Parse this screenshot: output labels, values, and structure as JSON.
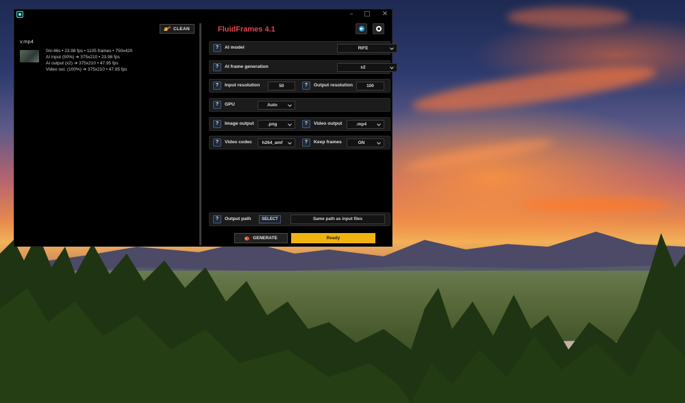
{
  "window": {
    "controls": {
      "minimize": "–",
      "maximize": "□",
      "close": "✕"
    }
  },
  "left_panel": {
    "clean_label": "CLEAN",
    "file_name": "v.mp4",
    "file_info": [
      "0m:46s • 23.98 fps • 1105 frames • 750x420",
      "AI input (50%) ➔ 375x210 • 23.98 fps",
      "AI output (x2) ➔ 375x210 • 47.95 fps",
      "Video out. (100%) ➔ 375x210 • 47.95 fps"
    ]
  },
  "header": {
    "title": "FluidFrames 4.1",
    "icons": [
      "telegram-icon",
      "github-icon"
    ]
  },
  "settings": {
    "help_symbol": "?",
    "ai_model": {
      "label": "AI model",
      "value": "RIFE"
    },
    "ai_frame_generation": {
      "label": "AI frame generation",
      "value": "x2"
    },
    "input_resolution": {
      "label": "Input resolution",
      "value": "50"
    },
    "output_resolution": {
      "label": "Output resolution",
      "value": "100"
    },
    "gpu": {
      "label": "GPU",
      "value": "Auto"
    },
    "image_output": {
      "label": "Image output",
      "value": ".png"
    },
    "video_output": {
      "label": "Video output",
      "value": ".mp4"
    },
    "video_codec": {
      "label": "Video codec",
      "value": "h264_amf"
    },
    "keep_frames": {
      "label": "Keep frames",
      "value": "ON"
    },
    "output_path": {
      "label": "Output path",
      "select_label": "SELECT",
      "value": "Same path as input files"
    }
  },
  "footer": {
    "generate_label": "GENERATE",
    "status": "Ready"
  },
  "colors": {
    "accent_title": "#e04850",
    "status_bar": "#f0b312",
    "window_bg": "#000000",
    "row_bg": "#1b1b1b"
  }
}
